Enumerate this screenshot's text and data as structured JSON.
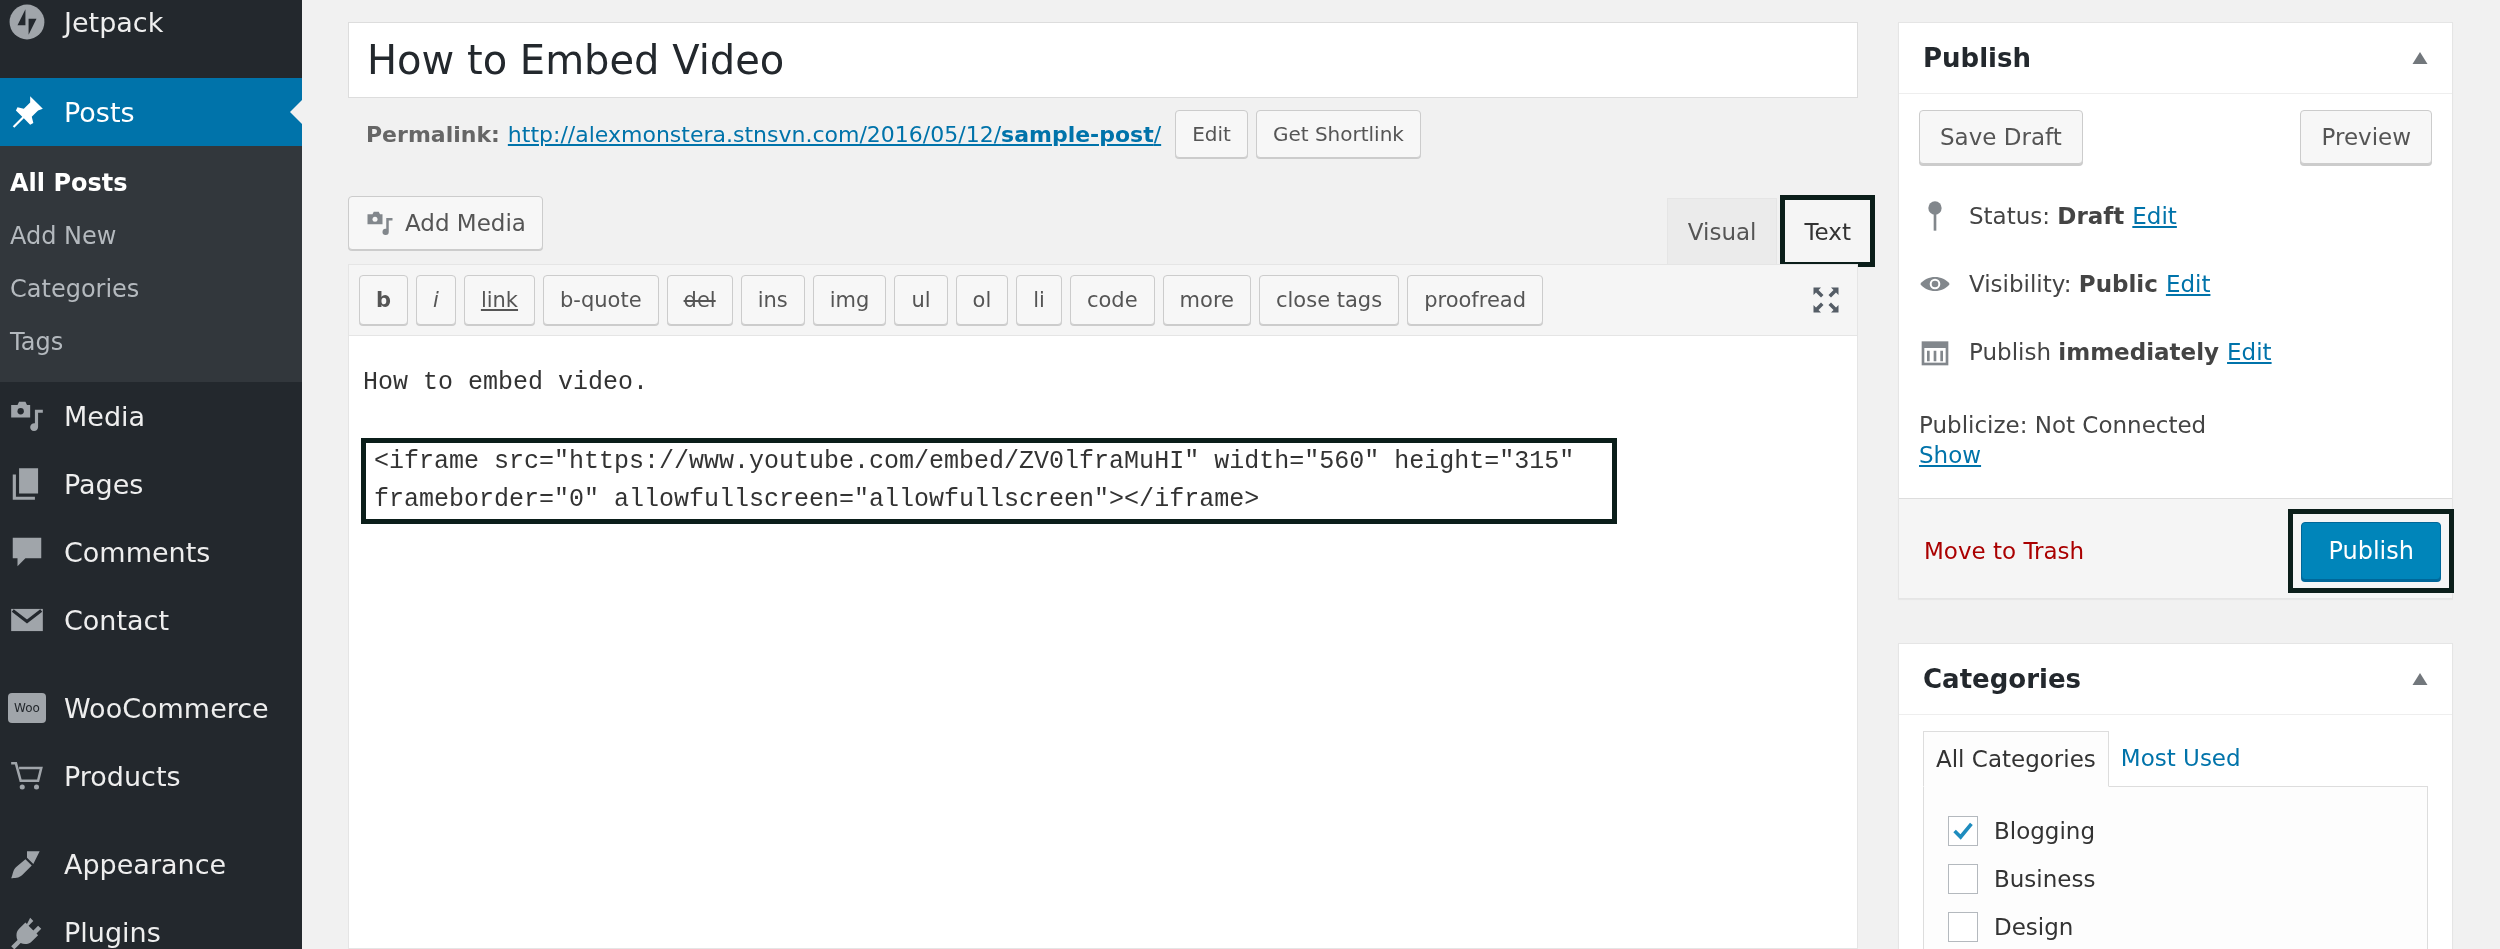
{
  "sidebar": {
    "groups": [
      {
        "items": [
          {
            "label": "Jetpack",
            "kind": "jetpack",
            "selected": false
          }
        ]
      },
      {
        "items": [
          {
            "label": "Posts",
            "kind": "pin",
            "selected": true,
            "children": [
              {
                "label": "All Posts",
                "selected": true
              },
              {
                "label": "Add New",
                "selected": false
              },
              {
                "label": "Categories",
                "selected": false
              },
              {
                "label": "Tags",
                "selected": false
              }
            ]
          },
          {
            "label": "Media",
            "kind": "media",
            "selected": false
          },
          {
            "label": "Pages",
            "kind": "pages",
            "selected": false
          },
          {
            "label": "Comments",
            "kind": "comment",
            "selected": false
          },
          {
            "label": "Contact",
            "kind": "mail",
            "selected": false
          }
        ]
      },
      {
        "items": [
          {
            "label": "WooCommerce",
            "kind": "woo",
            "icon_text": "Woo",
            "selected": false
          },
          {
            "label": "Products",
            "kind": "cart",
            "selected": false
          }
        ]
      },
      {
        "items": [
          {
            "label": "Appearance",
            "kind": "brush",
            "selected": false
          },
          {
            "label": "Plugins",
            "kind": "plug",
            "selected": false
          }
        ]
      }
    ]
  },
  "editor": {
    "title": "How to Embed Video",
    "permalink": {
      "label": "Permalink:",
      "url_base": "http://alexmonstera.stnsvn.com/2016/05/12/",
      "url_slug": "sample-post",
      "url_end": "/",
      "buttons": [
        "Edit",
        "Get Shortlink"
      ]
    },
    "add_media": "Add Media",
    "tabs": [
      {
        "label": "Visual",
        "selected": false,
        "highlighted": false
      },
      {
        "label": "Text",
        "selected": true,
        "highlighted": true
      }
    ],
    "quicktags": [
      "b",
      "i",
      "link",
      "b-quote",
      "del",
      "ins",
      "img",
      "ul",
      "ol",
      "li",
      "code",
      "more",
      "close tags",
      "proofread"
    ],
    "content": [
      {
        "text": "How to embed video.",
        "highlighted": false
      },
      {
        "text": "<iframe src=\"https://www.youtube.com/embed/ZV0lfraMuHI\" width=\"560\" height=\"315\" frameborder=\"0\" allowfullscreen=\"allowfullscreen\"></iframe>",
        "highlighted": true
      }
    ]
  },
  "publish_box": {
    "title": "Publish",
    "save_draft": "Save Draft",
    "preview": "Preview",
    "rows": [
      {
        "kind": "status",
        "label": "Status:",
        "value": "Draft",
        "link": "Edit"
      },
      {
        "kind": "visibility",
        "label": "Visibility:",
        "value": "Public",
        "link": "Edit"
      },
      {
        "kind": "schedule",
        "label": "Publish",
        "value": "immediately",
        "link": "Edit"
      }
    ],
    "publicize": "Publicize: Not Connected",
    "publicize_link": "Show",
    "trash": "Move to Trash",
    "publish": {
      "label": "Publish",
      "highlighted": true
    }
  },
  "categories_box": {
    "title": "Categories",
    "tabs": [
      {
        "label": "All Categories",
        "selected": true
      },
      {
        "label": "Most Used",
        "selected": false
      }
    ],
    "items": [
      {
        "label": "Blogging",
        "checked": true
      },
      {
        "label": "Business",
        "checked": false
      },
      {
        "label": "Design",
        "checked": false
      }
    ]
  }
}
